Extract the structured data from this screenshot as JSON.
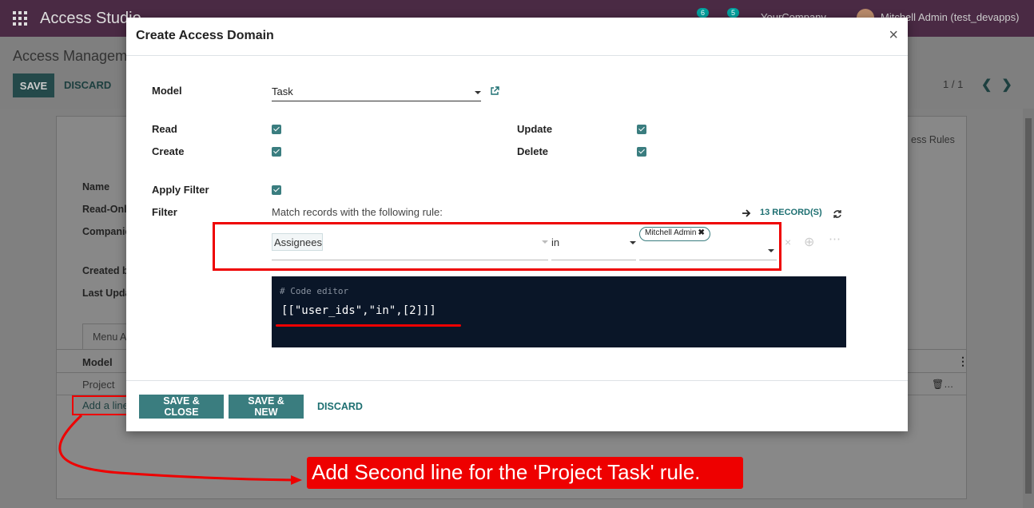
{
  "topbar": {
    "app_title": "Access Studio",
    "company": "YourCompany",
    "user": "Mitchell Admin (test_devapps)",
    "messages_count": "6",
    "activities_count": "5"
  },
  "control_panel": {
    "breadcrumb": "Access Managem",
    "save_label": "SAVE",
    "discard_label": "DISCARD",
    "pager": "1 / 1"
  },
  "background_sheet": {
    "name_label": "Name",
    "readonly_label": "Read-Only",
    "companies_label": "Companie",
    "created_by_label": "Created b",
    "last_updated_label": "Last Upda",
    "rules_tab": "ess Rules",
    "menu_tab": "Menu A",
    "list_header_model": "Model",
    "list_row_model": "Project",
    "trash_label": "…",
    "add_line": "Add a line"
  },
  "modal": {
    "title": "Create Access Domain",
    "close": "×",
    "model_label": "Model",
    "model_value": "Task",
    "read_label": "Read",
    "create_label": "Create",
    "update_label": "Update",
    "delete_label": "Delete",
    "apply_filter_label": "Apply Filter",
    "filter_label": "Filter",
    "filter_description": "Match records with the following rule:",
    "records_link": "13 RECORD(S)",
    "rule": {
      "field": "Assignees",
      "operator": "in",
      "value_tag": "Mitchell Admin"
    },
    "code_comment": "# Code editor",
    "code_domain": "[[\"user_ids\",\"in\",[2]]]",
    "buttons": {
      "save_close": "SAVE & CLOSE",
      "save_new": "SAVE & NEW",
      "discard": "DISCARD"
    }
  },
  "annotation": {
    "callout_text": "Add Second line for the 'Project Task' rule."
  }
}
